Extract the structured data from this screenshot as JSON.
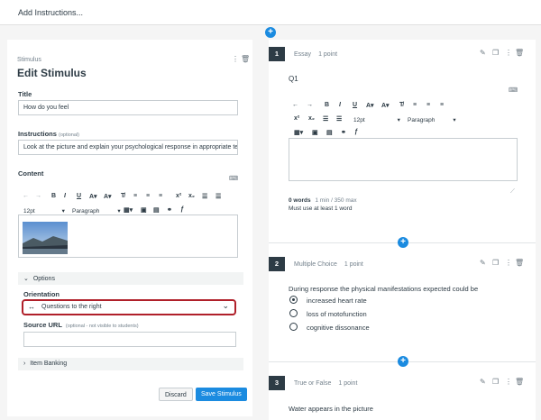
{
  "header": {
    "add_instructions": "Add Instructions..."
  },
  "stimulus": {
    "section_label": "Stimulus",
    "heading": "Edit Stimulus",
    "title_label": "Title",
    "title_value": "How do you feel",
    "instructions_label": "Instructions",
    "instructions_optional": "(optional)",
    "instructions_value": "Look at the picture and explain your psychological response in appropriate ter",
    "content_label": "Content",
    "font_size": "12pt",
    "paragraph": "Paragraph",
    "options_label": "Options",
    "orientation_label": "Orientation",
    "orientation_value": "Questions to the right",
    "source_url_label": "Source URL",
    "source_url_note": "(optional - not visible to students)",
    "source_url_value": "",
    "item_banking_label": "Item Banking",
    "discard_label": "Discard",
    "save_label": "Save Stimulus"
  },
  "questions": [
    {
      "number": "1",
      "type": "Essay",
      "points": "1 point",
      "title": "Q1",
      "font_size": "12pt",
      "paragraph": "Paragraph",
      "word_count": "0 words",
      "limit": "1 min / 350 max",
      "requirement": "Must use at least 1 word"
    },
    {
      "number": "2",
      "type": "Multiple Choice",
      "points": "1 point",
      "prompt": "During response the physical manifestations expected could be",
      "options": [
        "increased heart rate",
        "loss of motofunction",
        "cognitive dissonance"
      ]
    },
    {
      "number": "3",
      "type": "True or False",
      "points": "1 point",
      "prompt": "Water appears in the picture"
    }
  ],
  "colors": {
    "accent": "#1b8be0",
    "highlight": "#b0202a",
    "dark": "#2d3b45"
  }
}
